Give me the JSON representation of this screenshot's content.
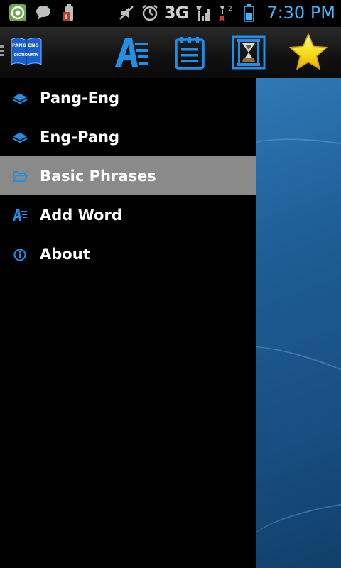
{
  "status_bar": {
    "network": "3G",
    "time": "7:30 PM",
    "time_color": "#3fb6ff"
  },
  "action_bar": {
    "logo": {
      "icon": "book-icon",
      "text_top_left": "PANG",
      "text_top_right": "ENG",
      "text_bottom": "DICTIONARY"
    },
    "actions": [
      {
        "icon": "add-word-icon"
      },
      {
        "icon": "notepad-icon"
      },
      {
        "icon": "hourglass-icon"
      },
      {
        "icon": "star-icon"
      }
    ]
  },
  "drawer": {
    "items": [
      {
        "label": "Pang-Eng",
        "icon": "book-icon",
        "selected": false
      },
      {
        "label": "Eng-Pang",
        "icon": "book-icon",
        "selected": false
      },
      {
        "label": "Basic Phrases",
        "icon": "folder-open-icon",
        "selected": true
      },
      {
        "label": "Add Word",
        "icon": "add-word-icon",
        "selected": false
      },
      {
        "label": "About",
        "icon": "info-icon",
        "selected": false
      }
    ]
  },
  "colors": {
    "accent_blue": "#1f8fe8",
    "selected_bg": "#8a8a8a",
    "content_bg": "#1e5d95"
  }
}
